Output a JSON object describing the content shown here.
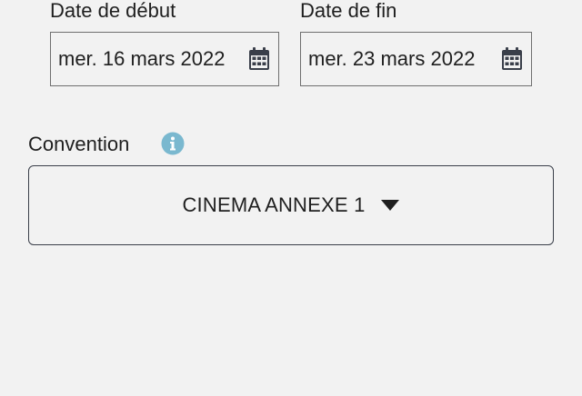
{
  "dates": {
    "start": {
      "label": "Date de début",
      "value": "mer. 16 mars 2022",
      "icon": "calendar-icon"
    },
    "end": {
      "label": "Date de fin",
      "value": "mer. 23 mars 2022",
      "icon": "calendar-icon"
    }
  },
  "convention": {
    "label": "Convention",
    "info_icon": "info-icon",
    "selected": "CINEMA ANNEXE 1",
    "dropdown_icon": "caret-down-icon"
  },
  "colors": {
    "background": "#f2f2f2",
    "text": "#1f1f1f",
    "info_accent": "#7ab8cf",
    "border": "#3a3f4a"
  }
}
